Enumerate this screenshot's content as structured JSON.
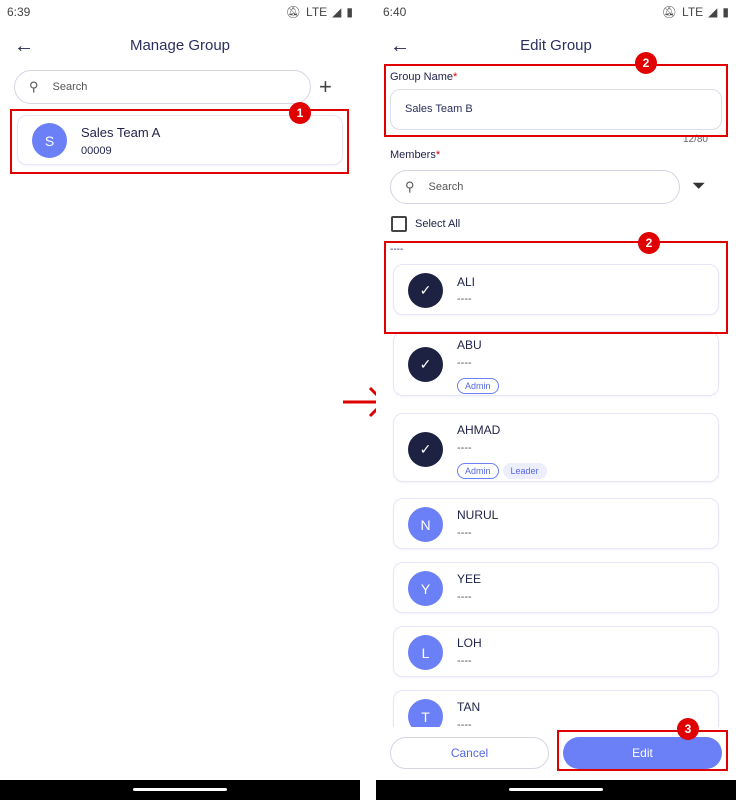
{
  "left": {
    "status": {
      "time": "6:39",
      "network": "LTE"
    },
    "header": {
      "title": "Manage Group"
    },
    "search": {
      "placeholder": "Search"
    },
    "groups": [
      {
        "initial": "S",
        "name": "Sales Team A",
        "code": "00009"
      }
    ],
    "annotation": "1"
  },
  "right": {
    "status": {
      "time": "6:40",
      "network": "LTE"
    },
    "header": {
      "title": "Edit Group"
    },
    "group_name": {
      "label": "Group Name",
      "required": "*",
      "value": "Sales Team B",
      "counter": "12/80",
      "annotation": "2"
    },
    "members": {
      "label": "Members",
      "required": "*",
      "search_placeholder": "Search",
      "select_all": "Select All",
      "section_header": "----",
      "annotation": "2"
    },
    "member_list": [
      {
        "name": "ALI",
        "sub": "----",
        "selected": true,
        "tags": []
      },
      {
        "name": "ABU",
        "sub": "----",
        "selected": true,
        "tags": [
          "Admin"
        ]
      },
      {
        "name": "AHMAD",
        "sub": "----",
        "selected": true,
        "tags": [
          "Admin",
          "Leader"
        ]
      },
      {
        "name": "NURUL",
        "initial": "N",
        "sub": "----",
        "selected": false
      },
      {
        "name": "YEE",
        "initial": "Y",
        "sub": "----",
        "selected": false
      },
      {
        "name": "LOH",
        "initial": "L",
        "sub": "----",
        "selected": false
      },
      {
        "name": "TAN",
        "initial": "T",
        "sub": "----",
        "selected": false
      }
    ],
    "actions": {
      "cancel": "Cancel",
      "edit": "Edit",
      "annotation": "3"
    }
  },
  "colors": {
    "accent": "#6b7ff7",
    "selected": "#1d2142",
    "annotation": "#e00000"
  }
}
